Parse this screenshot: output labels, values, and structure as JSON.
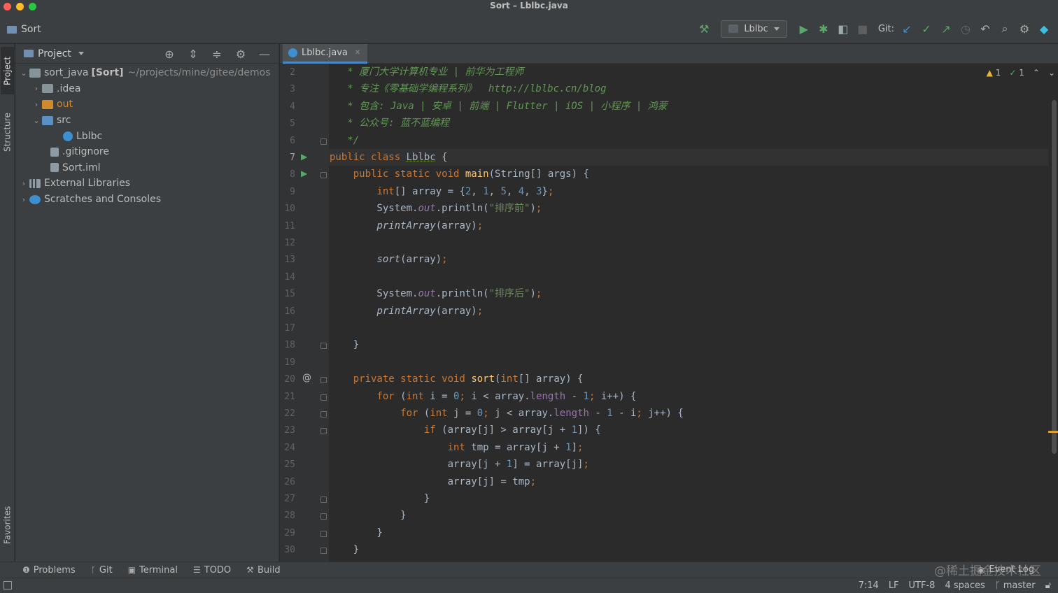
{
  "window": {
    "title": "Sort – Lblbc.java"
  },
  "toolbar": {
    "breadcrumb": "Sort",
    "run_config": "Lblbc",
    "git_label": "Git:"
  },
  "left_tabs": {
    "project": "Project",
    "structure": "Structure",
    "favorites": "Favorites"
  },
  "project_panel": {
    "title": "Project",
    "tree": {
      "root_name": "sort_java",
      "root_module": "[Sort]",
      "root_path": "~/projects/mine/gitee/demos",
      "idea": ".idea",
      "out": "out",
      "src": "src",
      "lblbc": "Lblbc",
      "gitignore": ".gitignore",
      "iml": "Sort.iml",
      "libs": "External Libraries",
      "scratches": "Scratches and Consoles"
    }
  },
  "editor": {
    "tab_label": "Lblbc.java",
    "inspections": {
      "warnings": "1",
      "ok": "1"
    },
    "current_line": 7,
    "line_numbers": [
      "2",
      "3",
      "4",
      "5",
      "6",
      "7",
      "8",
      "9",
      "10",
      "11",
      "12",
      "13",
      "14",
      "15",
      "16",
      "17",
      "18",
      "19",
      "20",
      "21",
      "22",
      "23",
      "24",
      "25",
      "26",
      "27",
      "28",
      "29",
      "30"
    ]
  },
  "bottom_tools": {
    "problems": "Problems",
    "git": "Git",
    "terminal": "Terminal",
    "todo": "TODO",
    "build": "Build",
    "event_log": "Event Log"
  },
  "watermark": "@稀土掘金技术社区",
  "status": {
    "position": "7:14",
    "line_sep": "LF",
    "encoding": "UTF-8",
    "indent": "4 spaces",
    "branch": "master"
  },
  "colors": {
    "keyword": "#cc7832",
    "comment": "#629755",
    "string": "#6a8759",
    "number": "#6897bb",
    "method": "#ffc66d",
    "field": "#9876aa",
    "background": "#2b2b2b"
  }
}
